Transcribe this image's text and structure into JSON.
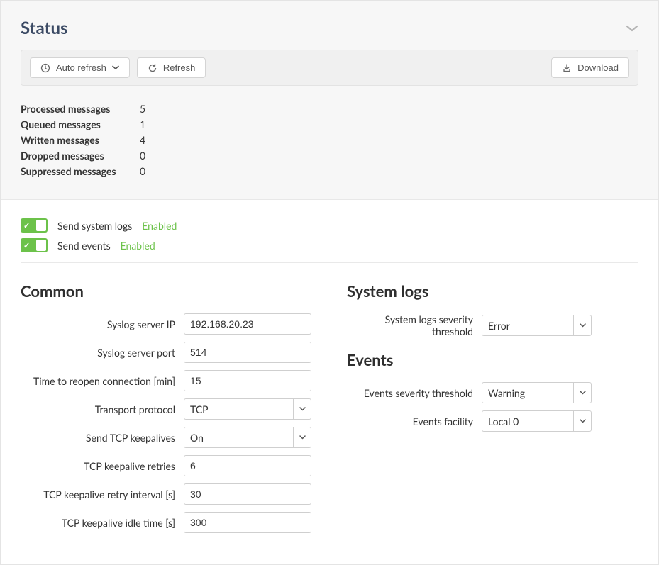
{
  "status": {
    "title": "Status",
    "buttons": {
      "auto_refresh": "Auto refresh",
      "refresh": "Refresh",
      "download": "Download"
    },
    "stats": {
      "processed_label": "Processed messages",
      "processed_val": "5",
      "queued_label": "Queued messages",
      "queued_val": "1",
      "written_label": "Written messages",
      "written_val": "4",
      "dropped_label": "Dropped messages",
      "dropped_val": "0",
      "suppressed_label": "Suppressed messages",
      "suppressed_val": "0"
    }
  },
  "toggles": {
    "send_system_logs_label": "Send system logs",
    "send_system_logs_state": "Enabled",
    "send_events_label": "Send events",
    "send_events_state": "Enabled"
  },
  "common": {
    "title": "Common",
    "syslog_ip_label": "Syslog server IP",
    "syslog_ip_val": "192.168.20.23",
    "syslog_port_label": "Syslog server port",
    "syslog_port_val": "514",
    "reopen_label": "Time to reopen connection [min]",
    "reopen_val": "15",
    "transport_label": "Transport protocol",
    "transport_val": "TCP",
    "keepalives_label": "Send TCP keepalives",
    "keepalives_val": "On",
    "retries_label": "TCP keepalive retries",
    "retries_val": "6",
    "retry_interval_label": "TCP keepalive retry interval [s]",
    "retry_interval_val": "30",
    "idle_time_label": "TCP keepalive idle time [s]",
    "idle_time_val": "300"
  },
  "system_logs": {
    "title": "System logs",
    "severity_label": "System logs severity threshold",
    "severity_val": "Error"
  },
  "events": {
    "title": "Events",
    "severity_label": "Events severity threshold",
    "severity_val": "Warning",
    "facility_label": "Events facility",
    "facility_val": "Local 0"
  }
}
